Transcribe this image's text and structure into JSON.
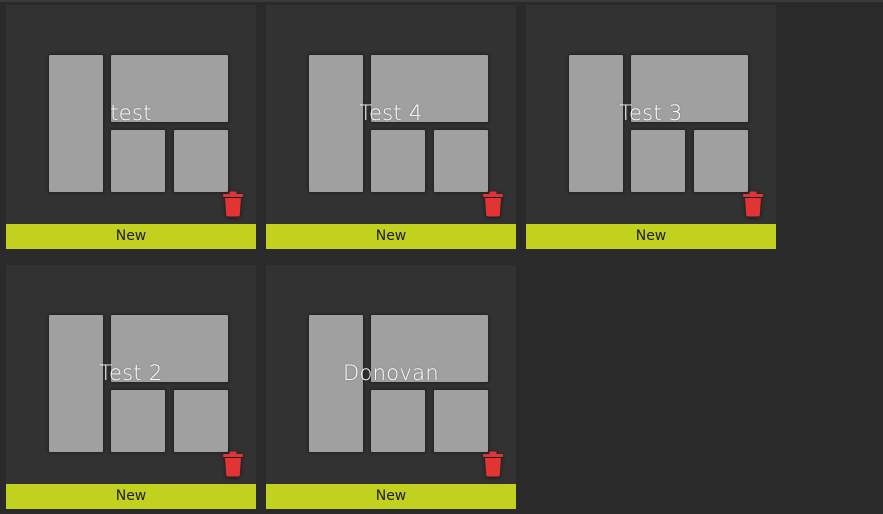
{
  "colors": {
    "background": "#2a2a2a",
    "card": "#323232",
    "placeholder": "#a0a0a0",
    "status_bar": "#c2d11e",
    "delete_icon": "#e23434"
  },
  "cards": [
    {
      "title": "test",
      "status": "New",
      "icon": "trash-icon"
    },
    {
      "title": "Test 4",
      "status": "New",
      "icon": "trash-icon"
    },
    {
      "title": "Test 3",
      "status": "New",
      "icon": "trash-icon"
    },
    {
      "title": "Test 2",
      "status": "New",
      "icon": "trash-icon"
    },
    {
      "title": "Donovan",
      "status": "New",
      "icon": "trash-icon"
    }
  ]
}
